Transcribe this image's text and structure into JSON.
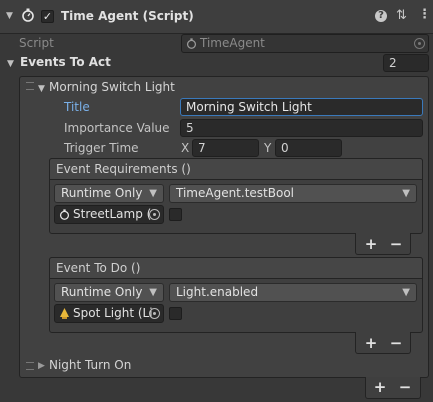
{
  "component": {
    "title": "Time Agent (Script)",
    "enabled": true
  },
  "script_row": {
    "label": "Script",
    "value": "TimeAgent"
  },
  "events_to_act": {
    "label": "Events To Act",
    "count": "2"
  },
  "event0": {
    "name": "Morning Switch Light",
    "title_label": "Title",
    "title_value": "Morning Switch Light",
    "importance_label": "Importance Value",
    "importance_value": "5",
    "trigger_label": "Trigger Time",
    "x_label": "X",
    "x_value": "7",
    "y_label": "Y",
    "y_value": "0",
    "requirements": {
      "header": "Event Requirements ()",
      "runtime": "Runtime Only",
      "function": "TimeAgent.testBool",
      "object": "StreetLamp ("
    },
    "todo": {
      "header": "Event To Do ()",
      "runtime": "Runtime Only",
      "function": "Light.enabled",
      "object": "Spot Light (Li"
    }
  },
  "event1": {
    "name": "Night Turn On"
  },
  "buttons": {
    "plus": "+",
    "minus": "−"
  },
  "colors": {
    "accent": "#3a79bb",
    "background": "#383838"
  }
}
